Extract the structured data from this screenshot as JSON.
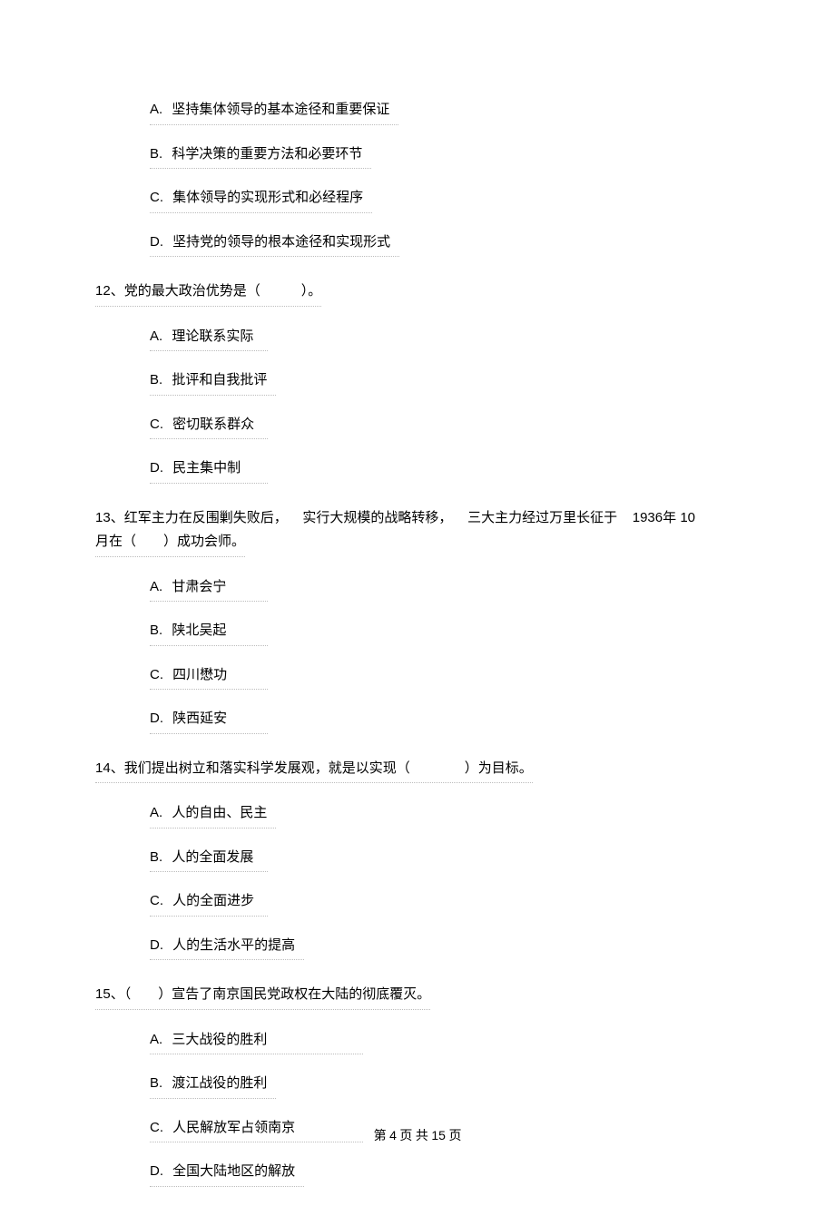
{
  "q11_options": {
    "A": "坚持集体领导的基本途径和重要保证",
    "B": "科学决策的重要方法和必要环节",
    "C": "集体领导的实现形式和必经程序",
    "D": "坚持党的领导的根本途径和实现形式"
  },
  "q12": {
    "num": "12",
    "text": "、党的最大政治优势是（　　　）。",
    "options": {
      "A": "理论联系实际",
      "B": "批评和自我批评",
      "C": "密切联系群众",
      "D": "民主集中制"
    }
  },
  "q13": {
    "num": "13",
    "line1_a": "、红军主力在反围剿失败后，",
    "line1_b": "实行大规模的战略转移，",
    "line1_c": "三大主力经过万里长征于",
    "year": "1936",
    "line1_d": "年",
    "line1_e": "10",
    "line2": "月在（　　）成功会师。",
    "options": {
      "A": "甘肃会宁",
      "B": "陕北吴起",
      "C": "四川懋功",
      "D": "陕西延安"
    }
  },
  "q14": {
    "num": "14",
    "text": "、我们提出树立和落实科学发展观，就是以实现（　　　　）为目标。",
    "options": {
      "A": "人的自由、民主",
      "B": "人的全面发展",
      "C": "人的全面进步",
      "D": "人的生活水平的提高"
    }
  },
  "q15": {
    "num": "15",
    "text": "、（　　）宣告了南京国民党政权在大陆的彻底覆灭。",
    "options": {
      "A": "三大战役的胜利",
      "B": "渡江战役的胜利",
      "C": "人民解放军占领南京",
      "D": "全国大陆地区的解放"
    }
  },
  "footer": {
    "pre": "第",
    "page": "4",
    "mid": "页 共",
    "total": "15",
    "post": "页"
  }
}
